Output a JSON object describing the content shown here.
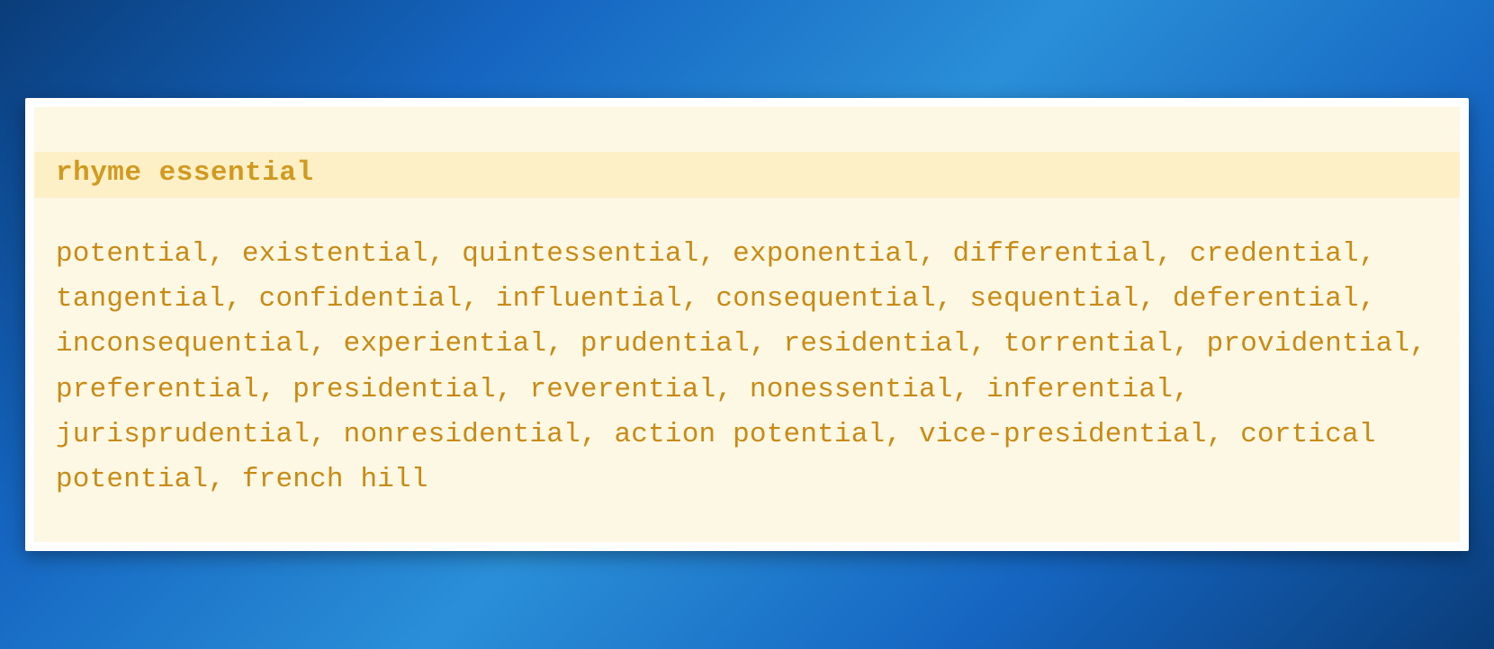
{
  "query": {
    "text": "rhyme essential"
  },
  "results": {
    "words": [
      "potential",
      "existential",
      "quintessential",
      "exponential",
      "differential",
      "credential",
      "tangential",
      "confidential",
      "influential",
      "consequential",
      "sequential",
      "deferential",
      "inconsequential",
      "experiential",
      "prudential",
      "residential",
      "torrential",
      "providential",
      "preferential",
      "presidential",
      "reverential",
      "nonessential",
      "inferential",
      "jurisprudential",
      "nonresidential",
      "action potential",
      "vice-presidential",
      "cortical potential",
      "french hill"
    ]
  }
}
